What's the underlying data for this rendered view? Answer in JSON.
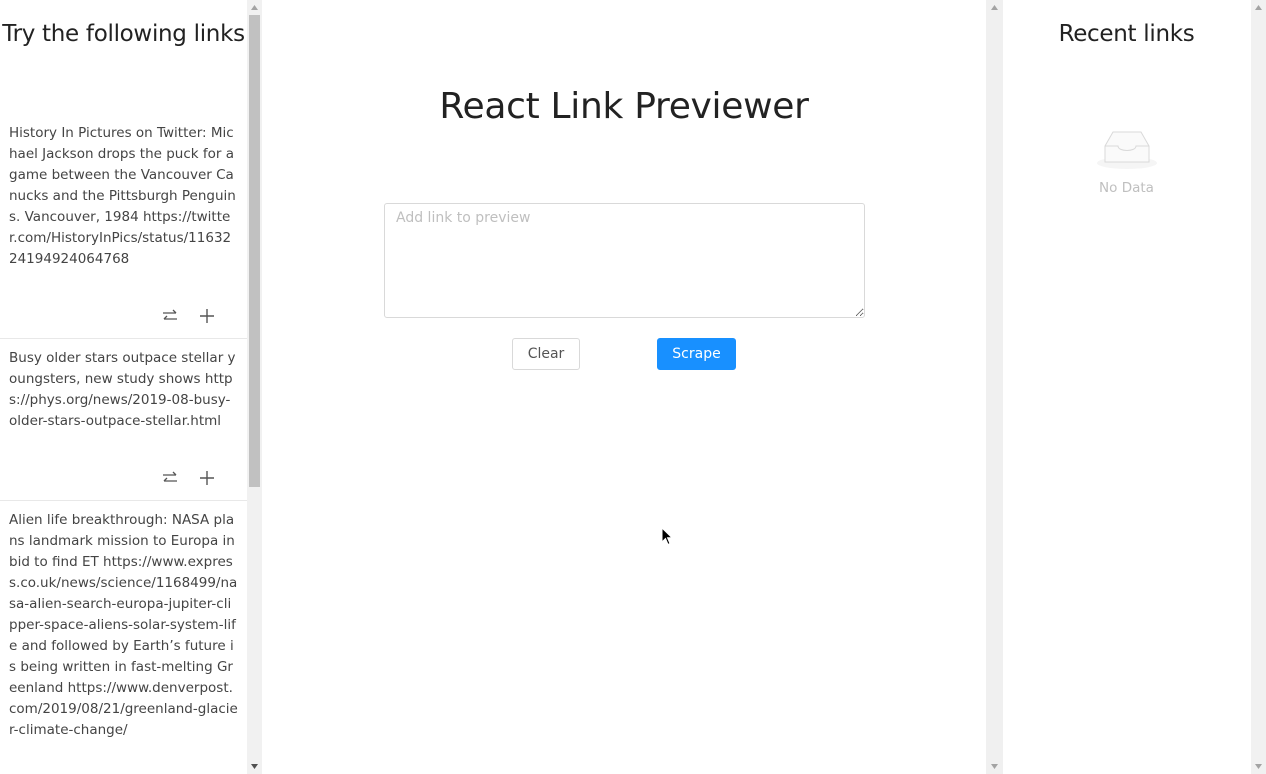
{
  "left_sidebar": {
    "title": "Try the following links",
    "cards": [
      {
        "text": "History In Pictures on Twitter: Michael Jackson drops the puck for a game between the Vancouver Canucks and the Pittsburgh Penguins. Vancouver, 1984 https://twitter.com/HistoryInPics/status/1163224194924064768",
        "actions": [
          "swap-icon",
          "plus-icon"
        ]
      },
      {
        "text": "Busy older stars outpace stellar youngsters, new study shows https://phys.org/news/2019-08-busy-older-stars-outpace-stellar.html",
        "actions": [
          "swap-icon",
          "plus-icon"
        ]
      },
      {
        "text": "Alien life breakthrough: NASA plans landmark mission to Europa in bid to find ET https://www.express.co.uk/news/science/1168499/nasa-alien-search-europa-jupiter-clipper-space-aliens-solar-system-life and followed by Earth’s future is being written in fast-melting Greenland https://www.denverpost.com/2019/08/21/greenland-glacier-climate-change/"
      }
    ]
  },
  "main": {
    "title": "React Link Previewer",
    "input": {
      "placeholder": "Add link to preview",
      "value": ""
    },
    "clear_label": "Clear",
    "scrape_label": "Scrape"
  },
  "right_sidebar": {
    "title": "Recent links",
    "empty_text": "No Data"
  },
  "colors": {
    "primary": "#1890ff",
    "placeholder": "#bfbfbf",
    "border": "#d9d9d9"
  }
}
